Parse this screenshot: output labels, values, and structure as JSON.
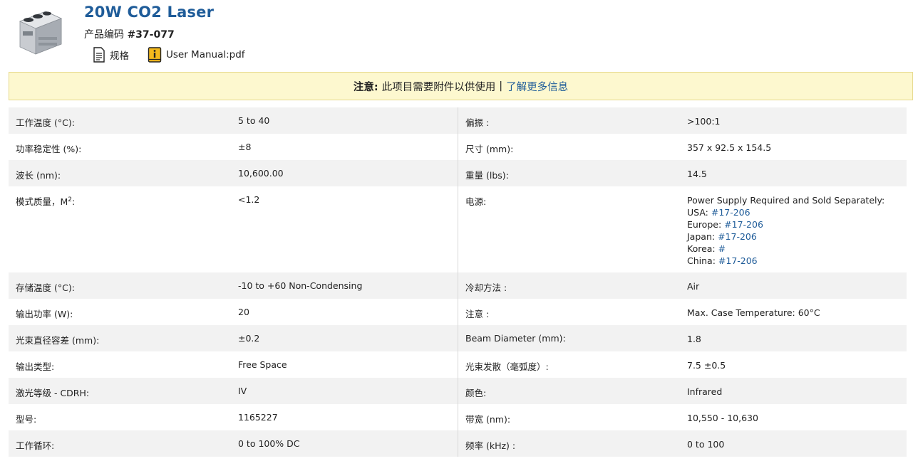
{
  "product": {
    "title": "20W CO2 Laser",
    "code_label": "产品编码",
    "code_value": "#37-077",
    "links": [
      {
        "label": "规格",
        "icon": "document-icon"
      },
      {
        "label": "User Manual:pdf",
        "icon": "info-book-icon"
      }
    ]
  },
  "notice": {
    "label": "注意:",
    "text": "此项目需要附件以供使用",
    "separator": "|",
    "link": "了解更多信息"
  },
  "specs": [
    {
      "l1": "工作温度 (°C):",
      "v1": "5 to 40",
      "l2": "偏振 :",
      "v2": ">100:1"
    },
    {
      "l1": "功率稳定性 (%):",
      "v1": "±8",
      "l2": "尺寸 (mm):",
      "v2": "357 x 92.5 x 154.5"
    },
    {
      "l1": "波长 (nm):",
      "v1": "10,600.00",
      "l2": "重量 (lbs):",
      "v2": "14.5"
    },
    {
      "l1": "模式质量，M",
      "l1_sup": "2",
      "l1_suffix": ":",
      "v1": "<1.2",
      "l2": "电源:",
      "v2_lines": [
        {
          "text": "Power Supply Required and Sold Separately:",
          "link": ""
        },
        {
          "text": "USA: ",
          "link": "#17-206"
        },
        {
          "text": "Europe: ",
          "link": "#17-206"
        },
        {
          "text": "Japan: ",
          "link": "#17-206"
        },
        {
          "text": "Korea: ",
          "link": "#"
        },
        {
          "text": "China: ",
          "link": "#17-206"
        }
      ]
    },
    {
      "l1": "存储温度 (°C):",
      "v1": "-10 to +60 Non-Condensing",
      "l2": "冷却方法 :",
      "v2": "Air"
    },
    {
      "l1": "输出功率 (W):",
      "v1": "20",
      "l2": "注意 :",
      "v2": "Max. Case Temperature: 60°C"
    },
    {
      "l1": "光束直径容差 (mm):",
      "v1": "±0.2",
      "l2": "Beam Diameter (mm):",
      "v2": "1.8"
    },
    {
      "l1": "输出类型:",
      "v1": "Free Space",
      "l2": "光束发散（毫弧度）:",
      "v2": "7.5 ±0.5"
    },
    {
      "l1": "激光等级 - CDRH:",
      "v1": "IV",
      "l2": "颜色:",
      "v2": "Infrared"
    },
    {
      "l1": "型号:",
      "v1": "1165227",
      "l2": "带宽 (nm):",
      "v2": "10,550 - 10,630"
    },
    {
      "l1": "工作循环:",
      "v1": "0 to 100% DC",
      "l2": "频率 (kHz) :",
      "v2": "0 to 100"
    }
  ],
  "colors": {
    "title": "#1f5c99",
    "link": "#1f5c99",
    "notice_bg": "#fdf8cf",
    "row_alt": "#f2f2f2"
  }
}
